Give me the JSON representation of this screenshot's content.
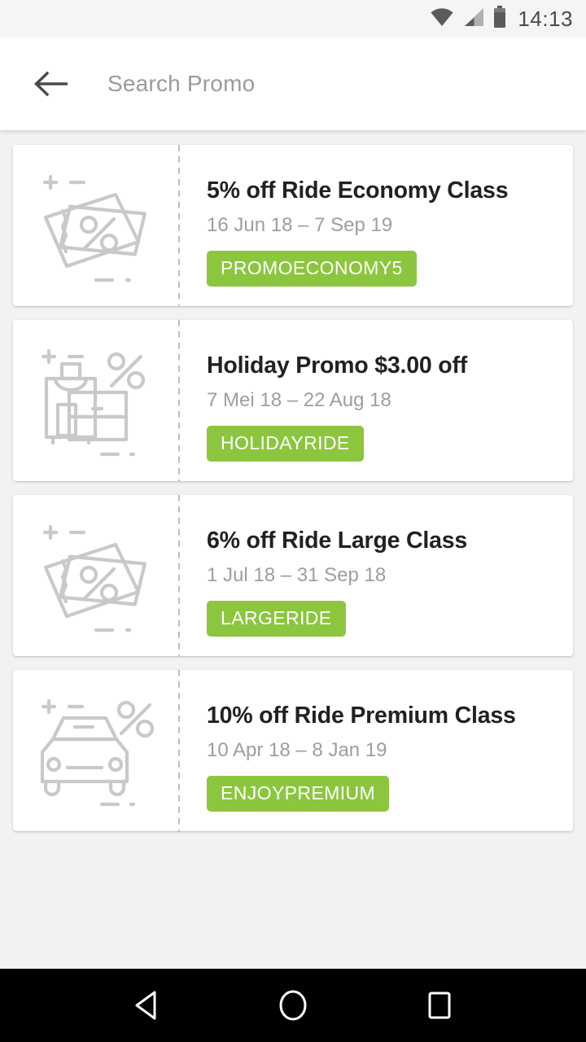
{
  "status_bar": {
    "time": "14:13",
    "icons": [
      "wifi-icon",
      "cellular-signal-icon",
      "battery-icon"
    ]
  },
  "toolbar": {
    "back_icon": "back-arrow-icon",
    "search_placeholder": "Search Promo",
    "search_value": ""
  },
  "theme": {
    "chip_green": "#8cc63e",
    "page_background": "#f2f2f2",
    "card_background": "#ffffff",
    "title_color": "#212121",
    "date_color": "#9e9e9e",
    "icon_grey": "#c9c9c9"
  },
  "promos": [
    {
      "icon": "coupon-tickets-percent-icon",
      "title": "5% off Ride Economy Class",
      "dates": "16 Jun 18 – 7 Sep 19",
      "code": "PROMOECONOMY5"
    },
    {
      "icon": "luggage-suitcase-percent-icon",
      "title": "Holiday Promo $3.00 off",
      "dates": "7 Mei 18 – 22 Aug 18",
      "code": "HOLIDAYRIDE"
    },
    {
      "icon": "coupon-tickets-percent-icon",
      "title": "6% off Ride Large Class",
      "dates": "1 Jul 18 – 31 Sep 18",
      "code": "LARGERIDE"
    },
    {
      "icon": "car-front-percent-icon",
      "title": "10% off Ride Premium Class",
      "dates": "10 Apr 18 – 8 Jan 19",
      "code": "ENJOYPREMIUM"
    }
  ],
  "nav_bar": {
    "back_label": "back-triangle-icon",
    "home_label": "home-circle-icon",
    "recents_label": "recents-square-icon"
  }
}
